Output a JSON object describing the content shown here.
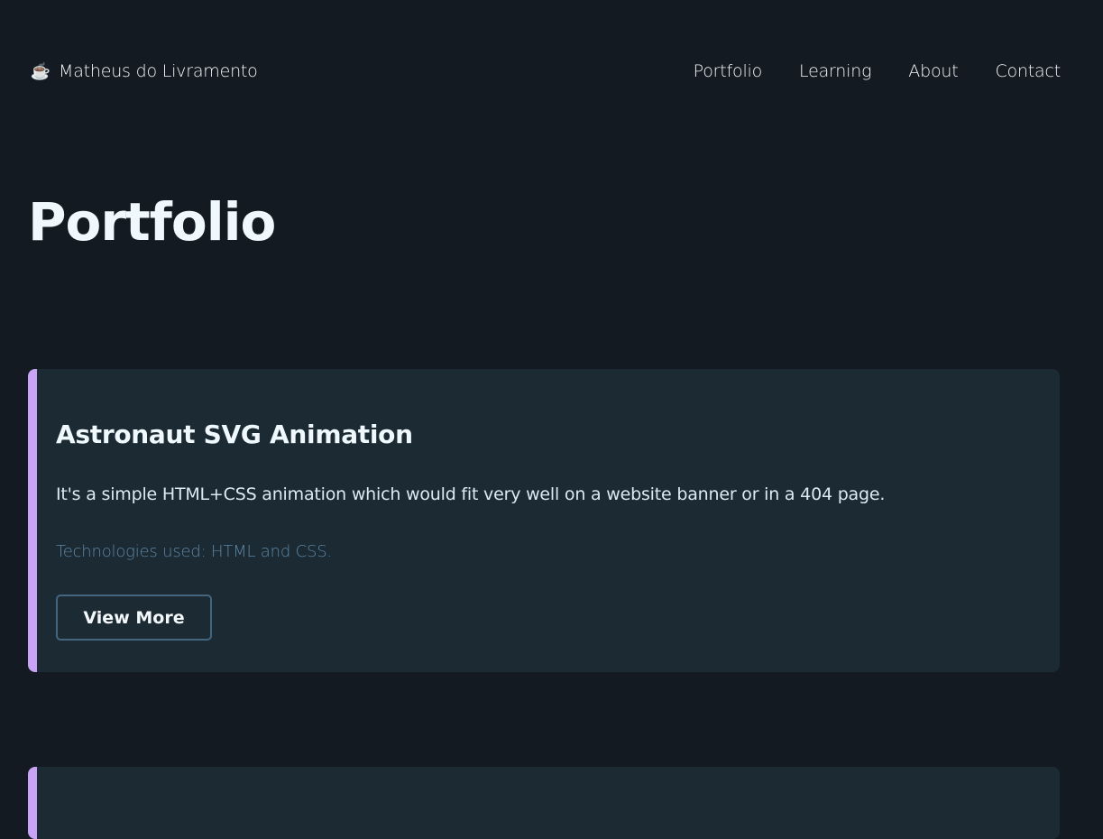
{
  "colors": {
    "background": "#131a21",
    "card_background": "#1c2a33",
    "card_accent": "#c9a3f5",
    "muted_text": "#5c86a6",
    "button_border": "#44657e"
  },
  "header": {
    "brand_icon": "coffee-icon",
    "brand_glyph": "☕",
    "brand_name": "Matheus do Livramento",
    "nav": [
      {
        "label": "Portfolio"
      },
      {
        "label": "Learning"
      },
      {
        "label": "About"
      },
      {
        "label": "Contact"
      }
    ]
  },
  "main": {
    "title": "Portfolio",
    "projects": [
      {
        "title": "Astronaut SVG Animation",
        "description": "It's a simple HTML+CSS animation which would fit very well on a website banner or in a 404 page.",
        "technologies": "Technologies used: HTML and CSS.",
        "button_label": "View More"
      }
    ]
  }
}
